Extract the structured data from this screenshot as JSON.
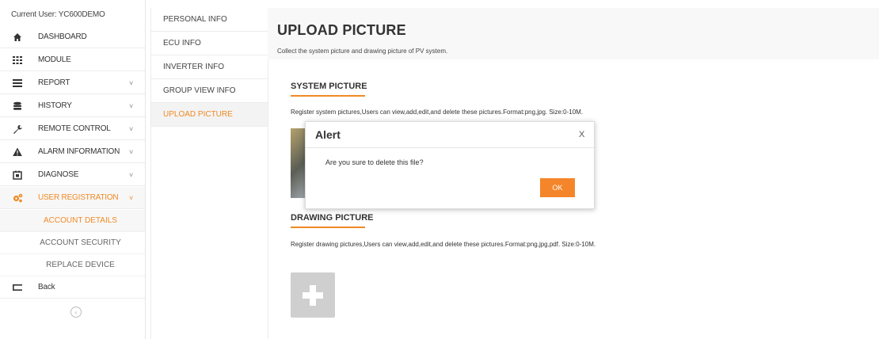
{
  "sidebar": {
    "current_user": "Current User: YC600DEMO",
    "items": [
      {
        "label": "DASHBOARD",
        "icon": "home-icon",
        "chevron": ""
      },
      {
        "label": "MODULE",
        "icon": "grid-icon",
        "chevron": ""
      },
      {
        "label": "REPORT",
        "icon": "list-icon",
        "chevron": "˅"
      },
      {
        "label": "HISTORY",
        "icon": "database-icon",
        "chevron": "˅"
      },
      {
        "label": "REMOTE CONTROL",
        "icon": "wrench-icon",
        "chevron": "˅"
      },
      {
        "label": "ALARM INFORMATION",
        "icon": "warning-icon",
        "chevron": "˅"
      },
      {
        "label": "DIAGNOSE",
        "icon": "diagnose-icon",
        "chevron": "˅"
      },
      {
        "label": "USER REGISTRATION",
        "icon": "gears-icon",
        "chevron": "˅"
      }
    ],
    "sub_items": [
      {
        "label": "ACCOUNT DETAILS"
      },
      {
        "label": "ACCOUNT SECURITY"
      },
      {
        "label": "REPLACE DEVICE"
      }
    ],
    "back_label": "Back",
    "collapse_glyph": "‹"
  },
  "tabs": [
    {
      "label": "PERSONAL INFO"
    },
    {
      "label": "ECU INFO"
    },
    {
      "label": "INVERTER INFO"
    },
    {
      "label": "GROUP VIEW INFO"
    },
    {
      "label": "UPLOAD PICTURE"
    }
  ],
  "page": {
    "title": "UPLOAD PICTURE",
    "description": "Collect the system picture and drawing picture of PV system.",
    "system_picture": {
      "title": "SYSTEM PICTURE",
      "description": "Register system pictures,Users can view,add,edit,and delete these pictures.Format:png,jpg. Size:0-10M."
    },
    "drawing_picture": {
      "title": "DRAWING PICTURE",
      "description": "Register drawing pictures,Users can view,add,edit,and delete these pictures.Format:png,jpg,pdf. Size:0-10M."
    }
  },
  "alert": {
    "title": "Alert",
    "close": "X",
    "message": "Are you sure to delete this file?",
    "ok_label": "OK"
  },
  "colors": {
    "accent": "#f08a24",
    "ok_button": "#f5852a"
  }
}
